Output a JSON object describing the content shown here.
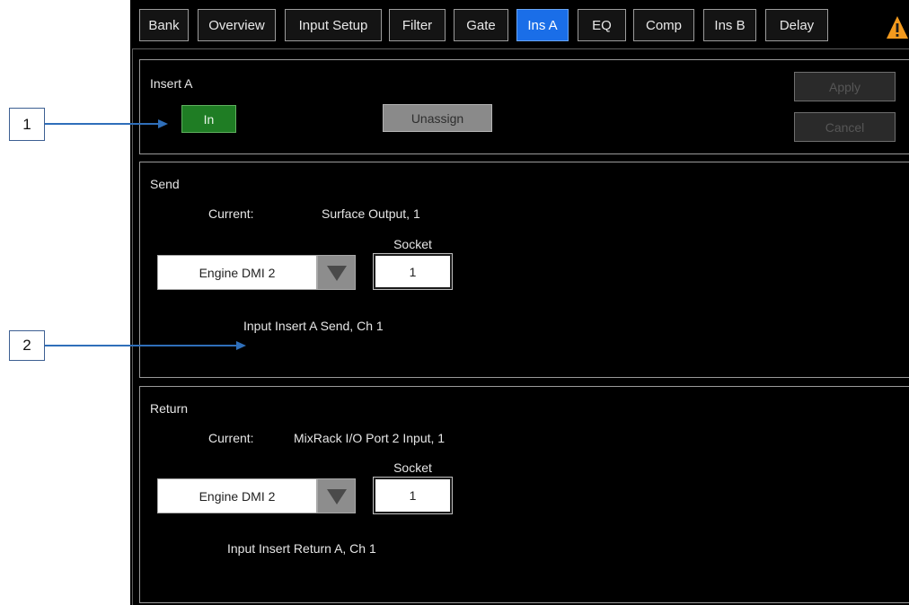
{
  "tabs": [
    {
      "label": "Bank",
      "active": false
    },
    {
      "label": "Overview",
      "active": false
    },
    {
      "label": "Input Setup",
      "active": false
    },
    {
      "label": "Filter",
      "active": false
    },
    {
      "label": "Gate",
      "active": false
    },
    {
      "label": "Ins A",
      "active": true
    },
    {
      "label": "EQ",
      "active": false
    },
    {
      "label": "Comp",
      "active": false
    },
    {
      "label": "Ins B",
      "active": false
    },
    {
      "label": "Delay",
      "active": false
    }
  ],
  "status_icon": "warning-triangle-icon",
  "insert": {
    "title": "Insert A",
    "in_button": {
      "label": "In",
      "on": true
    },
    "unassign_button": {
      "label": "Unassign"
    },
    "apply_button": {
      "label": "Apply",
      "enabled": false
    },
    "cancel_button": {
      "label": "Cancel",
      "enabled": false
    }
  },
  "send": {
    "title": "Send",
    "current_label": "Current:",
    "current_value": "Surface Output, 1",
    "device_select": {
      "value": "Engine DMI 2",
      "icon": "dropdown-arrow-icon"
    },
    "socket": {
      "label": "Socket",
      "value": "1"
    },
    "description": "Input Insert A Send, Ch 1"
  },
  "return": {
    "title": "Return",
    "current_label": "Current:",
    "current_value": "MixRack I/O Port 2 Input, 1",
    "device_select": {
      "value": "Engine DMI 2",
      "icon": "dropdown-arrow-icon"
    },
    "socket": {
      "label": "Socket",
      "value": "1"
    },
    "description": "Input Insert Return A, Ch 1"
  },
  "callouts": [
    {
      "label": "1"
    },
    {
      "label": "2"
    }
  ],
  "colors": {
    "screen_background": "#000000",
    "active_tab": "#1a6ee8",
    "in_button_on": "#1f7d24",
    "unassign_button": "#8a8a8a",
    "callout_arrow": "#2f6fba",
    "warning": "#f39a1e"
  }
}
